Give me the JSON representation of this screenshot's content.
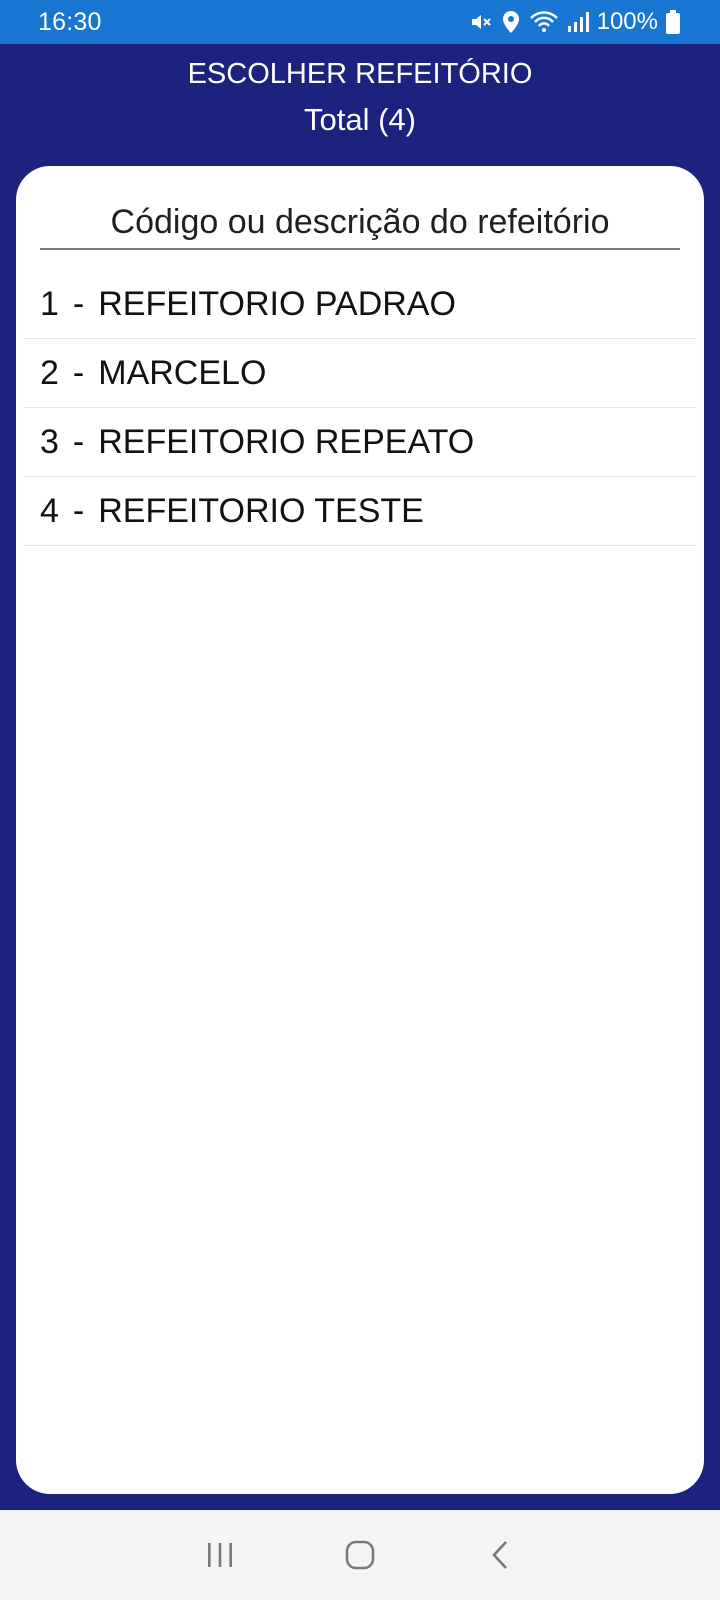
{
  "status_bar": {
    "time": "16:30",
    "battery": "100%",
    "icons": [
      "mute-icon",
      "location-icon",
      "wifi-icon",
      "signal-icon",
      "battery-icon"
    ]
  },
  "header": {
    "title": "ESCOLHER REFEITÓRIO",
    "total": "Total (4)"
  },
  "search": {
    "placeholder": "Código ou descrição do refeitório",
    "value": ""
  },
  "list": {
    "separator": "-",
    "items": [
      {
        "code": "1",
        "description": "REFEITORIO PADRAO"
      },
      {
        "code": "2",
        "description": "MARCELO"
      },
      {
        "code": "3",
        "description": "REFEITORIO REPEATO"
      },
      {
        "code": "4",
        "description": "REFEITORIO TESTE"
      }
    ]
  },
  "nav_bar": {
    "buttons": [
      "recents-icon",
      "home-icon",
      "back-icon"
    ]
  },
  "colors": {
    "status_bar": "#1976d2",
    "header": "#1b237e",
    "card": "#ffffff",
    "nav_bar": "#f4f4f4"
  }
}
